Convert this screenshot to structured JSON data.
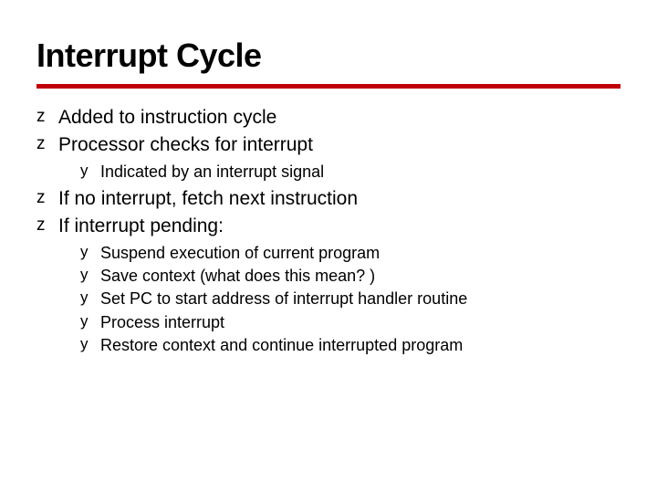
{
  "title": "Interrupt Cycle",
  "bullets": {
    "b0": "Added to instruction cycle",
    "b1": "Processor checks for interrupt",
    "b1_0": "Indicated by an interrupt signal",
    "b2": "If no interrupt, fetch next instruction",
    "b3": "If interrupt pending:",
    "b3_0": "Suspend execution of current program",
    "b3_1": "Save context  (what does this mean? )",
    "b3_2": "Set PC to start address of interrupt handler routine",
    "b3_3": "Process interrupt",
    "b3_4": "Restore context and continue interrupted program"
  }
}
